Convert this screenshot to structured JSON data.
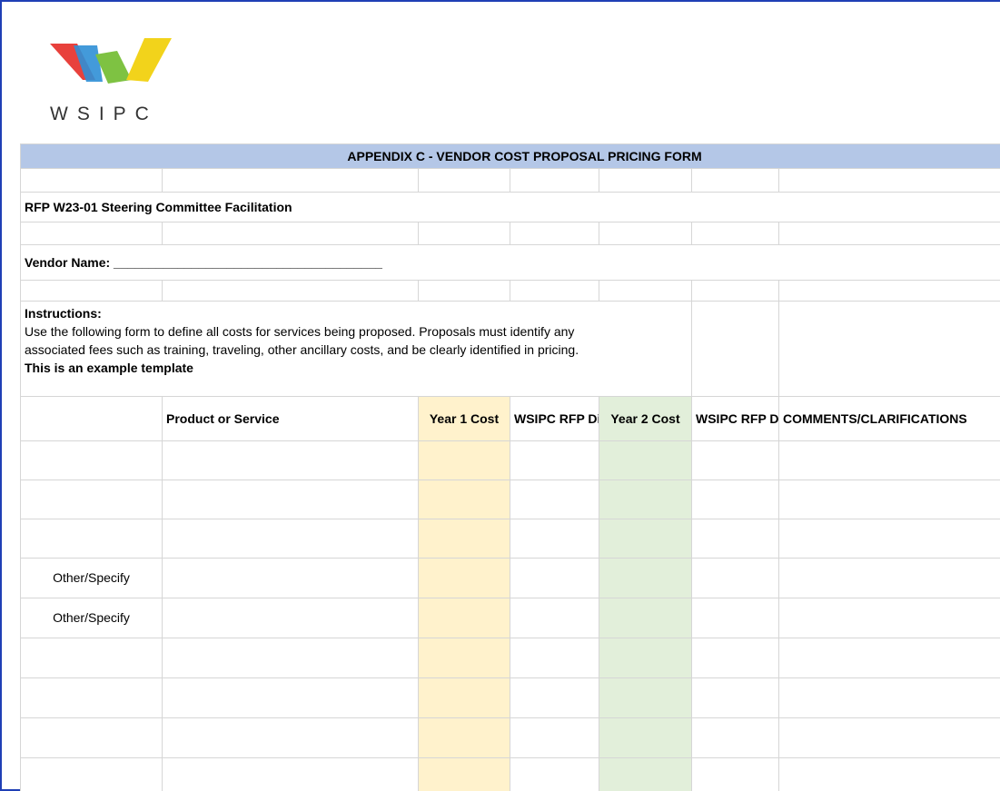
{
  "logo": {
    "text": "WSIPC",
    "colors": [
      "#e8413c",
      "#2f8fd6",
      "#7ec242",
      "#f2d31b"
    ]
  },
  "title": "APPENDIX C - VENDOR COST PROPOSAL PRICING FORM",
  "rfp_line": "RFP W23-01 Steering Committee Facilitation",
  "vendor_label": "Vendor Name: ______________________________________",
  "instructions": {
    "heading": "Instructions:",
    "line1": "Use the following form to define all costs for services being proposed. Proposals must identify any",
    "line2": "associated fees such as training, traveling, other ancillary costs, and be clearly identified in pricing.",
    "note": "This is an example template"
  },
  "table": {
    "headers": [
      "",
      "Product or Service",
      "Year 1 Cost",
      "WSIPC RFP Discount",
      "Year 2 Cost",
      "WSIPC RFP Discount",
      "COMMENTS/CLARIFICATIONS"
    ],
    "rows": [
      [
        "",
        "",
        "",
        "",
        "",
        "",
        ""
      ],
      [
        "",
        "",
        "",
        "",
        "",
        "",
        ""
      ],
      [
        "",
        "",
        "",
        "",
        "",
        "",
        ""
      ],
      [
        "Other/Specify",
        "",
        "",
        "",
        "",
        "",
        ""
      ],
      [
        "Other/Specify",
        "",
        "",
        "",
        "",
        "",
        ""
      ],
      [
        "",
        "",
        "",
        "",
        "",
        "",
        ""
      ],
      [
        "",
        "",
        "",
        "",
        "",
        "",
        ""
      ],
      [
        "",
        "",
        "",
        "",
        "",
        "",
        ""
      ],
      [
        "",
        "",
        "",
        "",
        "",
        "",
        ""
      ]
    ]
  }
}
